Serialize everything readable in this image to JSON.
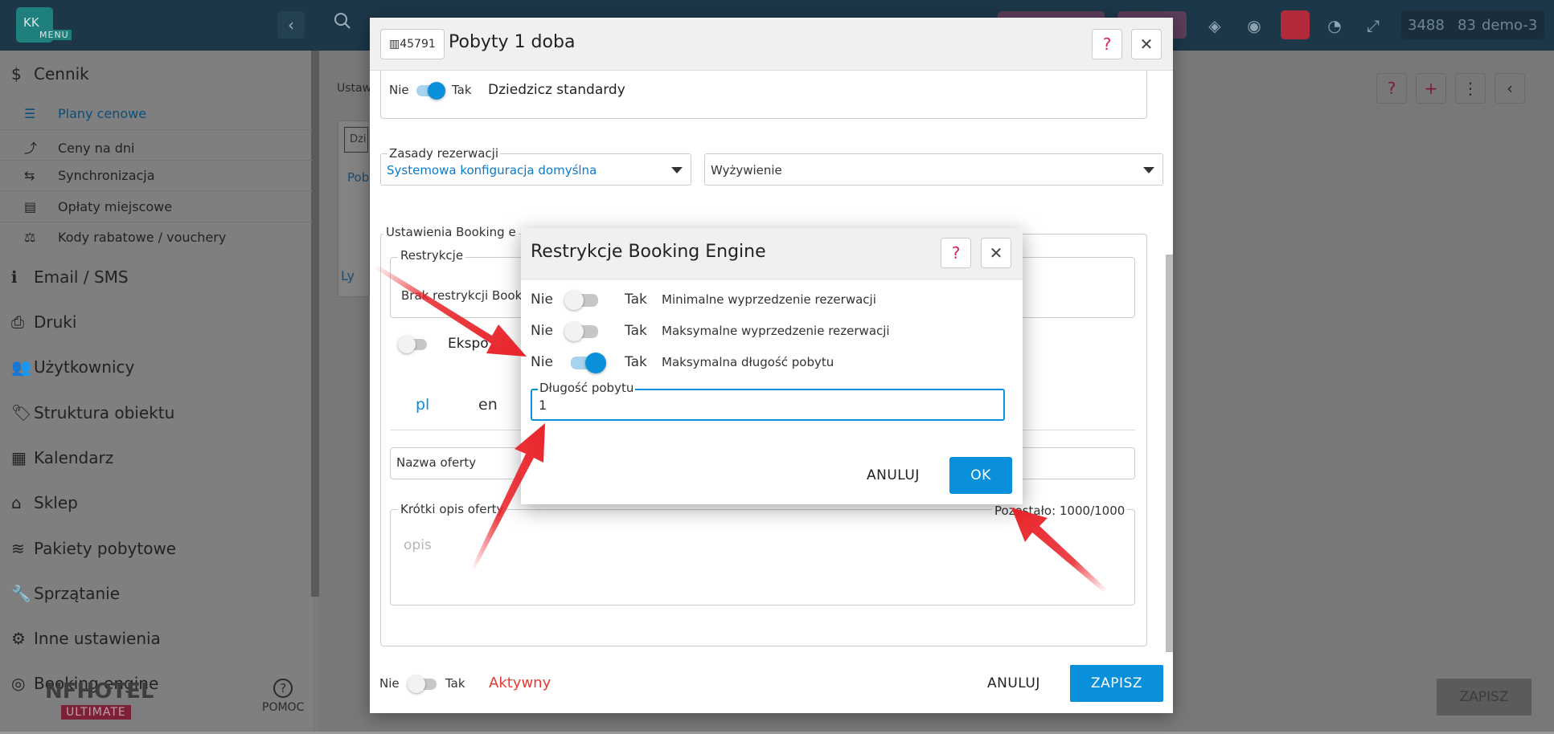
{
  "topbar": {
    "logo_initials": "KK",
    "logo_menu": "MENU",
    "stats": [
      "3488",
      "83",
      "demo-3"
    ]
  },
  "sidebar": {
    "items": [
      {
        "icon": "dollar-icon",
        "glyph": "$",
        "label": "Cennik"
      },
      {
        "icon": "info-icon",
        "glyph": "ℹ",
        "label": "Email / SMS"
      },
      {
        "icon": "printer-icon",
        "glyph": "⎙",
        "label": "Druki"
      },
      {
        "icon": "users-icon",
        "glyph": "👥",
        "label": "Użytkownicy"
      },
      {
        "icon": "tags-icon",
        "glyph": "🏷",
        "label": "Struktura obiektu"
      },
      {
        "icon": "calendar-icon",
        "glyph": "▦",
        "label": "Kalendarz"
      },
      {
        "icon": "shop-icon",
        "glyph": "⌂",
        "label": "Sklep"
      },
      {
        "icon": "database-icon",
        "glyph": "≋",
        "label": "Pakiety pobytowe"
      },
      {
        "icon": "wrench-icon",
        "glyph": "🔧",
        "label": "Sprzątanie"
      },
      {
        "icon": "cogs-icon",
        "glyph": "⚙",
        "label": "Inne ustawienia"
      },
      {
        "icon": "globe-icon",
        "glyph": "◎",
        "label": "Booking engine"
      }
    ],
    "subitems": [
      {
        "icon": "list-icon",
        "glyph": "☰",
        "label": "Plany cenowe",
        "active": true
      },
      {
        "icon": "chart-icon",
        "glyph": "⤴",
        "label": "Ceny na dni",
        "active": false
      },
      {
        "icon": "sync-icon",
        "glyph": "⇆",
        "label": "Synchronizacja",
        "active": false
      },
      {
        "icon": "calculator-icon",
        "glyph": "▤",
        "label": "Opłaty miejscowe",
        "active": false
      },
      {
        "icon": "balance-icon",
        "glyph": "⚖",
        "label": "Kody rabatowe / vouchery",
        "active": false
      }
    ],
    "help_label": "POMOC",
    "brand_name": "NFHOTEL",
    "brand_edition": "ULTIMATE"
  },
  "background": {
    "breadcrumb": "Ustaw",
    "input_fragment": "Dzi",
    "link_fragment": "Pob",
    "note_fragment": "Ly",
    "save_label": "ZAPISZ"
  },
  "modal": {
    "id_badge": "45791",
    "title": "Pobyty 1 doba",
    "inherit": {
      "no": "Nie",
      "yes": "Tak",
      "label": "Dziedzicz standardy",
      "on": true
    },
    "booking_rules": {
      "label": "Zasady rezerwacji",
      "value": "Systemowa konfiguracja domyślna"
    },
    "meal_select": {
      "value": "Wyżywienie"
    },
    "be_settings_legend": "Ustawienia Booking e",
    "restrictions_legend": "Restrykcje",
    "restrictions_value": "Brak restrykcji Book",
    "export_label": "Ekspo",
    "lang_tabs": [
      "pl",
      "en"
    ],
    "offer_name_label": "Nazwa oferty",
    "short_desc_label": "Krótki opis oferty",
    "remaining": "Pozostało: 1000/1000",
    "desc_placeholder": "opis",
    "active": {
      "no": "Nie",
      "yes": "Tak",
      "label": "Aktywny",
      "on": false
    },
    "cancel_label": "ANULUJ",
    "save_label": "ZAPISZ"
  },
  "dialog": {
    "title": "Restrykcje Booking Engine",
    "rows": [
      {
        "no": "Nie",
        "yes": "Tak",
        "label": "Minimalne wyprzedzenie rezerwacji",
        "on": false
      },
      {
        "no": "Nie",
        "yes": "Tak",
        "label": "Maksymalne wyprzedzenie rezerwacji",
        "on": false
      },
      {
        "no": "Nie",
        "yes": "Tak",
        "label": "Maksymalna długość pobytu",
        "on": true
      }
    ],
    "field_label": "Długość pobytu",
    "field_value": "1",
    "cancel_label": "ANULUJ",
    "ok_label": "OK"
  },
  "colors": {
    "accent": "#0a8fdb",
    "danger": "#e53935",
    "help": "#d6246b",
    "arrow": "#e8242a"
  }
}
